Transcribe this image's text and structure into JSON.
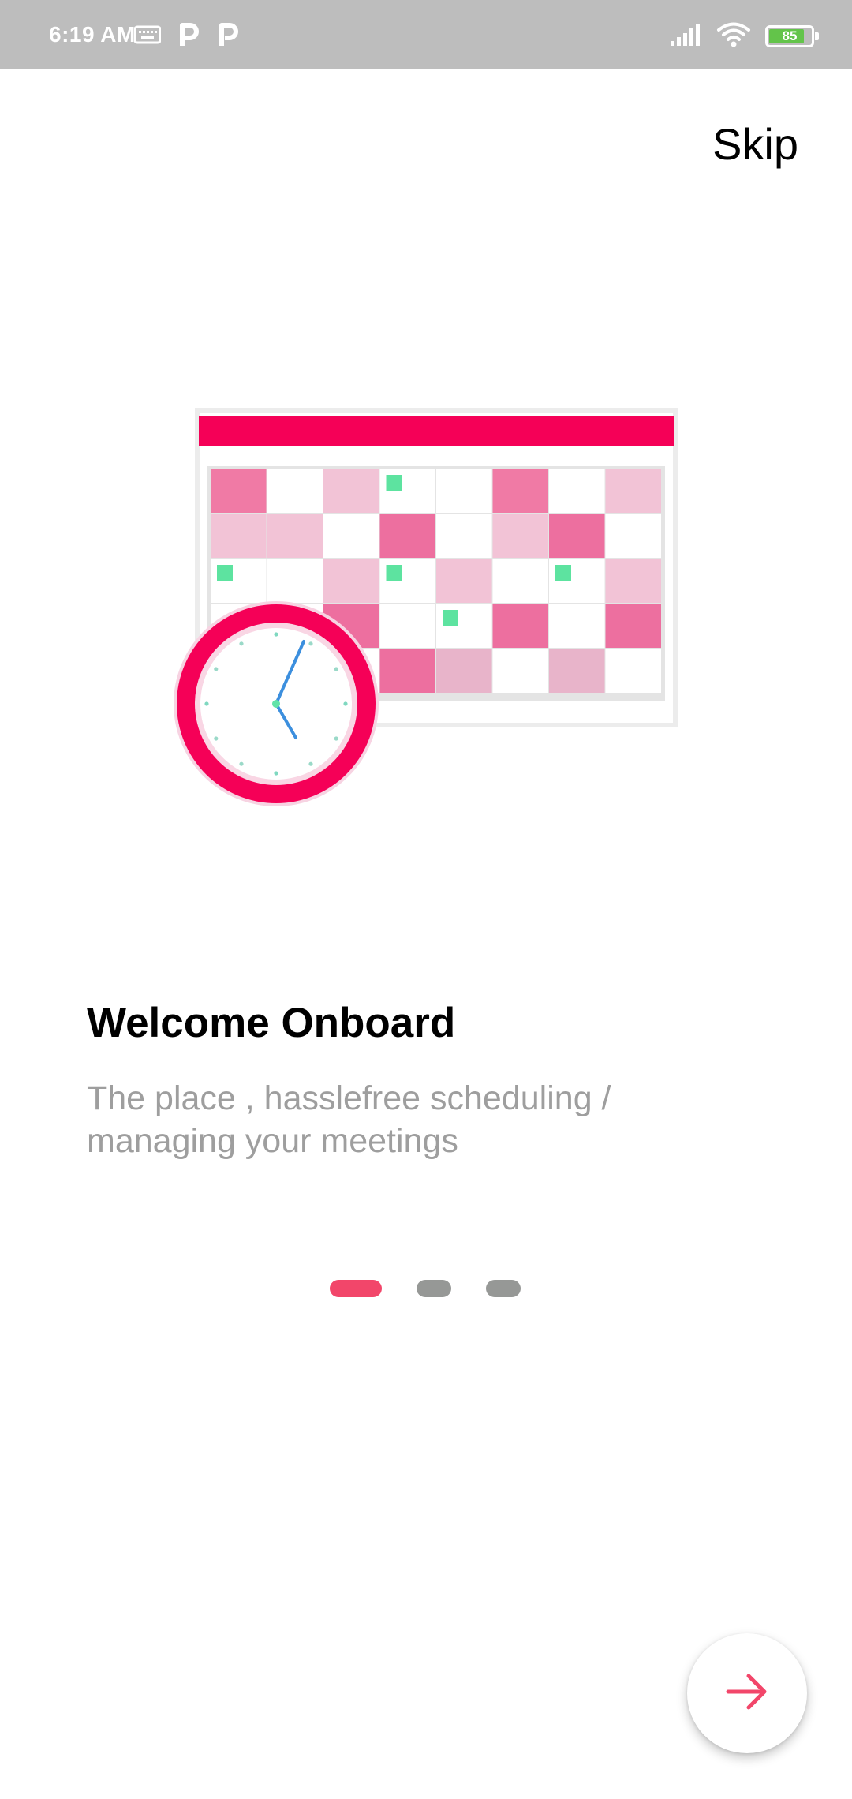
{
  "status_bar": {
    "time": "6:19 AM",
    "battery_level": "85",
    "battery_fraction": 0.85,
    "left_icons": [
      "keyboard-icon",
      "parking-p-icon",
      "parking-p-icon"
    ],
    "right_icons": [
      "signal-icon",
      "wifi-icon",
      "battery-icon"
    ]
  },
  "top_bar": {
    "skip_label": "Skip"
  },
  "onboarding": {
    "illustration": "calendar-clock-illustration",
    "title": "Welcome Onboard",
    "subtitle": "The place , hasslefree scheduling / managing your meetings"
  },
  "pager": {
    "total_pages": 3,
    "current_page": 1
  },
  "next_button": {
    "icon": "arrow-right-icon"
  },
  "colors": {
    "accent": "#f2466a",
    "calendar_header": "#f50057",
    "status_bar": "#bdbdbd",
    "subtitle_text": "#9e9e9e"
  }
}
